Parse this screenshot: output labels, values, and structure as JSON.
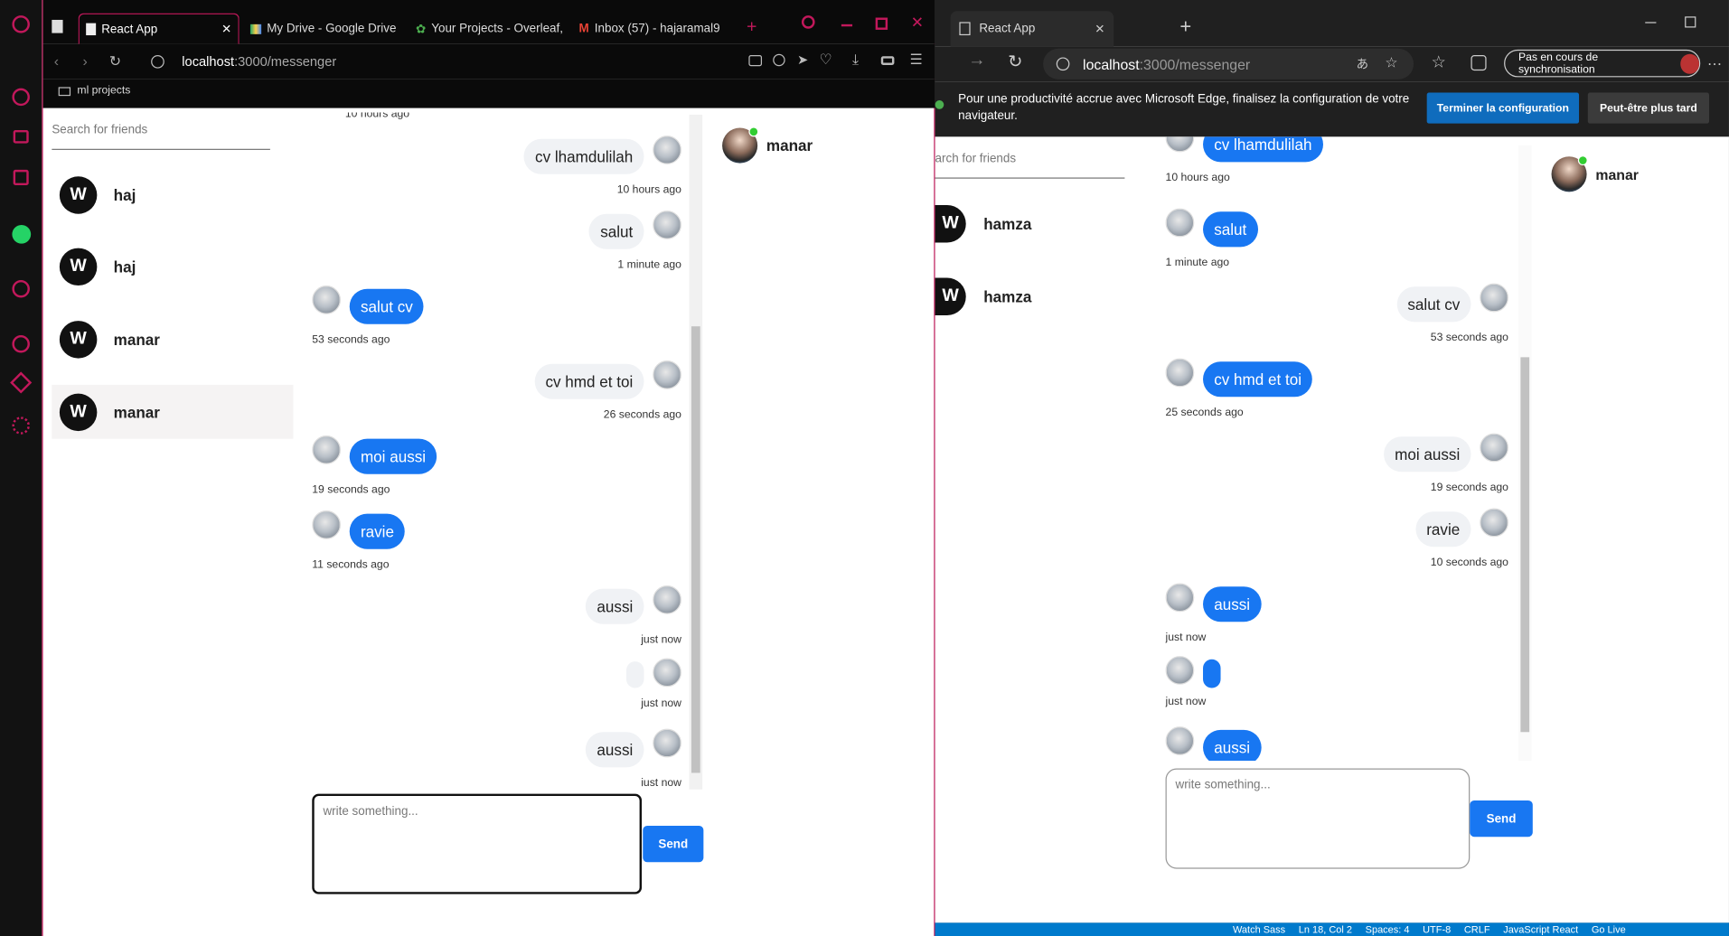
{
  "opera": {
    "tabs": [
      {
        "label": "React App"
      },
      {
        "label": "My Drive - Google Drive"
      },
      {
        "label": "Your Projects - Overleaf,"
      },
      {
        "label": "Inbox (57) - hajaramal9"
      }
    ],
    "url_host": "localhost",
    "url_path": ":3000/messenger",
    "bookmark": "ml projects",
    "search_placeholder": "Search for friends",
    "friends": [
      {
        "name": "haj"
      },
      {
        "name": "haj"
      },
      {
        "name": "manar"
      },
      {
        "name": "manar"
      }
    ],
    "messages": [
      {
        "text": "cv lhamdulilah",
        "time": "10 hours ago",
        "own": true
      },
      {
        "text": "salut",
        "time": "1 minute ago",
        "own": true
      },
      {
        "text": "salut cv",
        "time": "53 seconds ago",
        "own": false
      },
      {
        "text": "cv hmd et toi",
        "time": "26 seconds ago",
        "own": true
      },
      {
        "text": "moi aussi",
        "time": "19 seconds ago",
        "own": false
      },
      {
        "text": "ravie",
        "time": "11 seconds ago",
        "own": false
      },
      {
        "text": "aussi",
        "time": "just now",
        "own": true
      },
      {
        "text": "",
        "time": "just now",
        "own": true
      },
      {
        "text": "aussi",
        "time": "just now",
        "own": true
      }
    ],
    "textarea_placeholder": "write something...",
    "send_label": "Send",
    "online_friend": "manar"
  },
  "edge": {
    "tab": "React App",
    "url_host": "localhost",
    "url_path": ":3000/messenger",
    "sync_label": "Pas en cours de synchronisation",
    "banner_text": "Pour une productivité accrue avec Microsoft Edge, finalisez la configuration de votre navigateur.",
    "banner_primary": "Terminer la configuration",
    "banner_secondary": "Peut-être plus tard",
    "search_placeholder": "arch for friends",
    "friends": [
      {
        "name": "hamza"
      },
      {
        "name": "hamza"
      }
    ],
    "messages": [
      {
        "text": "cv lhamdulilah",
        "time": "10 hours ago",
        "own": false
      },
      {
        "text": "salut",
        "time": "1 minute ago",
        "own": false
      },
      {
        "text": "salut cv",
        "time": "53 seconds ago",
        "own": true
      },
      {
        "text": "cv hmd et toi",
        "time": "25 seconds ago",
        "own": false
      },
      {
        "text": "moi aussi",
        "time": "19 seconds ago",
        "own": true
      },
      {
        "text": "ravie",
        "time": "10 seconds ago",
        "own": true
      },
      {
        "text": "aussi",
        "time": "just now",
        "own": false
      },
      {
        "text": "",
        "time": "just now",
        "own": false
      },
      {
        "text": "aussi",
        "time": "",
        "own": false
      }
    ],
    "textarea_placeholder": "write something...",
    "send_label": "Send",
    "online_friend": "manar"
  },
  "vscode_status": [
    "Watch Sass",
    "Ln 18, Col 2",
    "Spaces: 4",
    "UTF-8",
    "CRLF",
    "JavaScript React",
    "Go Live"
  ],
  "colors": {
    "accent": "#1877f2",
    "opera_red": "#c2185b",
    "vscode_blue": "#007acc",
    "edge_blue": "#0f6cbd"
  }
}
